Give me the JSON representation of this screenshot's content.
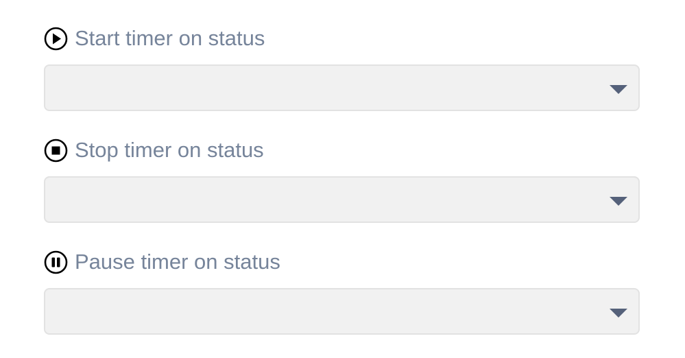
{
  "fields": [
    {
      "label": "Start timer on status",
      "icon": "play-circle-icon",
      "value": ""
    },
    {
      "label": "Stop timer on status",
      "icon": "stop-circle-icon",
      "value": ""
    },
    {
      "label": "Pause timer on status",
      "icon": "pause-circle-icon",
      "value": ""
    }
  ],
  "colors": {
    "label": "#76849a",
    "icon": "#000000",
    "select_background": "#f1f1f1",
    "select_border": "#e2e2e2",
    "caret": "#55617a"
  }
}
